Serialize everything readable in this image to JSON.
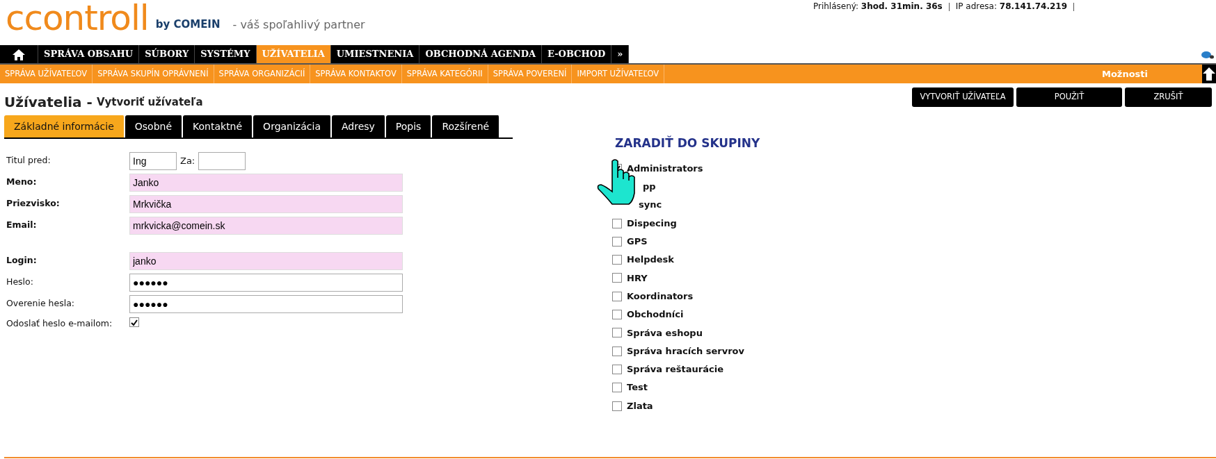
{
  "session": {
    "logged_label": "Prihlásený:",
    "logged_value": "3hod. 31min. 36s",
    "ip_label": "IP adresa:",
    "ip_value": "78.141.74.219"
  },
  "logo": {
    "name": "ccontroll",
    "by": "by COMEIN",
    "tagline": "- váš spoľahlivý partner"
  },
  "main_menu": [
    {
      "label": "SPRÁVA OBSAHU",
      "selected": false
    },
    {
      "label": "SÚBORY",
      "selected": false
    },
    {
      "label": "SYSTÉMY",
      "selected": false
    },
    {
      "label": "UŽÍVATELIA",
      "selected": true
    },
    {
      "label": "UMIESTNENIA",
      "selected": false
    },
    {
      "label": "OBCHODNÁ AGENDA",
      "selected": false
    },
    {
      "label": "E-OBCHOD",
      "selected": false
    },
    {
      "label": "»",
      "selected": false
    }
  ],
  "sub_menu": [
    "SPRÁVA UŽÍVATEĽOV",
    "SPRÁVA SKUPÍN OPRÁVNENÍ",
    "SPRÁVA ORGANIZÁCIÍ",
    "SPRÁVA KONTAKTOV",
    "SPRÁVA KATEGÓRII",
    "SPRÁVA POVERENÍ",
    "IMPORT UŽÍVATEĽOV"
  ],
  "options_label": "Možnosti",
  "page_title": {
    "section": "Užívatelia -",
    "action": "Vytvoriť užívateľa"
  },
  "actions": [
    "VYTVORIŤ UŽÍVATEĽA",
    "POUŽIŤ",
    "ZRUŠIŤ"
  ],
  "tabs": [
    {
      "label": "Základné informácie",
      "selected": true
    },
    {
      "label": "Osobné",
      "selected": false
    },
    {
      "label": "Kontaktné",
      "selected": false
    },
    {
      "label": "Organizácia",
      "selected": false
    },
    {
      "label": "Adresy",
      "selected": false
    },
    {
      "label": "Popis",
      "selected": false
    },
    {
      "label": "Rozšírené",
      "selected": false
    }
  ],
  "title_row": {
    "label": "Titul pred:",
    "before": "Ing",
    "after_label": "Za:"
  },
  "fields": [
    {
      "label": "Meno:",
      "value": "Janko",
      "required": true,
      "gap_before": false
    },
    {
      "label": "Priezvisko:",
      "value": "Mrkvička",
      "required": true,
      "gap_before": false
    },
    {
      "label": "Email:",
      "value": "mrkvicka@comein.sk",
      "required": true,
      "gap_before": false
    },
    {
      "label": "Login:",
      "value": "janko",
      "required": true,
      "gap_before": true
    },
    {
      "label": "Heslo:",
      "value": "●●●●●●",
      "required": false,
      "gap_before": false
    },
    {
      "label": "Overenie hesla:",
      "value": "●●●●●●",
      "required": false,
      "gap_before": false
    }
  ],
  "send_password": {
    "label": "Odoslať heslo e-mailom:",
    "checked": true
  },
  "groups_heading": "ZARADIŤ DO SKUPINY",
  "groups": [
    {
      "kind": "checkbox",
      "label": "Administrators",
      "checked": true
    },
    {
      "kind": "covered",
      "label": "pp"
    },
    {
      "kind": "covered",
      "label": "sync"
    },
    {
      "kind": "checkbox",
      "label": "Dispecing",
      "checked": false
    },
    {
      "kind": "checkbox",
      "label": "GPS",
      "checked": false
    },
    {
      "kind": "checkbox",
      "label": "Helpdesk",
      "checked": false
    },
    {
      "kind": "checkbox",
      "label": "HRY",
      "checked": false
    },
    {
      "kind": "checkbox",
      "label": "Koordinators",
      "checked": false
    },
    {
      "kind": "checkbox",
      "label": "Obchodníci",
      "checked": false
    },
    {
      "kind": "checkbox",
      "label": "Správa eshopu",
      "checked": false
    },
    {
      "kind": "checkbox",
      "label": "Správa hracích servrov",
      "checked": false
    },
    {
      "kind": "checkbox",
      "label": "Správa reštaurácie",
      "checked": false
    },
    {
      "kind": "checkbox",
      "label": "Test",
      "checked": false
    },
    {
      "kind": "checkbox",
      "label": "Zlata",
      "checked": false
    }
  ]
}
